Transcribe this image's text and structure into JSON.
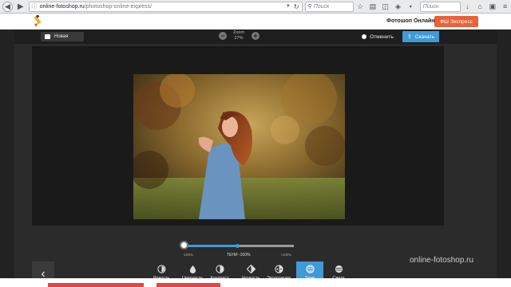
{
  "browser": {
    "url_host": "online-fotoshop.ru",
    "url_path": "/photoshop-online-express/",
    "search_placeholder": "Поиск",
    "search_placeholder_2": "Поиск"
  },
  "site": {
    "title": "Фотошоп Онлайн",
    "express_button": "ФШ Экспресс"
  },
  "editor": {
    "new_label": "Новая",
    "zoom_label": "Zoom",
    "zoom_value": "27%",
    "cancel_label": "Отменить",
    "download_label": "Скачать"
  },
  "slider": {
    "min_label": "-100%",
    "current_label": "ТЕНИ -100%",
    "max_label": "+100%",
    "value_fraction": 0.0
  },
  "tools": [
    {
      "label": "Яркость",
      "icon": "brightness-icon"
    },
    {
      "label": "Цветность",
      "icon": "saturation-icon"
    },
    {
      "label": "Контраст",
      "icon": "contrast-icon"
    },
    {
      "label": "Четкость",
      "icon": "sharpness-icon"
    },
    {
      "label": "Экспозиция",
      "icon": "exposure-icon"
    },
    {
      "label": "Тени",
      "icon": "shadows-icon",
      "active": true
    },
    {
      "label": "Света",
      "icon": "highlights-icon"
    }
  ],
  "watermark": "online-fotoshop.ru",
  "colors": {
    "accent": "#3f9ad8",
    "express": "#e8623a"
  }
}
